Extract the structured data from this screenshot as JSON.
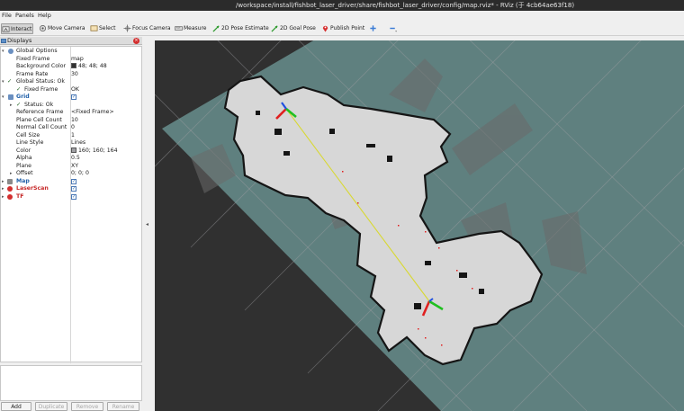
{
  "window": {
    "title": "/workspace/install/fishbot_laser_driver/share/fishbot_laser_driver/config/map.rviz* - RViz (于 4cb64ae63f18)"
  },
  "menu": {
    "file": "File",
    "panels": "Panels",
    "help": "Help"
  },
  "toolbar": {
    "interact": "Interact",
    "move_camera": "Move Camera",
    "select": "Select",
    "focus_camera": "Focus Camera",
    "measure": "Measure",
    "pose_estimate": "2D Pose Estimate",
    "goal_pose": "2D Goal Pose",
    "publish_point": "Publish Point"
  },
  "displays_panel": {
    "title": "Displays",
    "global_options": "Global Options",
    "fixed_frame": {
      "label": "Fixed Frame",
      "value": "map"
    },
    "background_color": {
      "label": "Background Color",
      "value": "48; 48; 48"
    },
    "frame_rate": {
      "label": "Frame Rate",
      "value": "30"
    },
    "global_status": "Global Status: Ok",
    "fixed_frame_status": {
      "label": "Fixed Frame",
      "value": "OK"
    },
    "grid": "Grid",
    "grid_status": "Status: Ok",
    "reference_frame": {
      "label": "Reference Frame",
      "value": "<Fixed Frame>"
    },
    "plane_cell_count": {
      "label": "Plane Cell Count",
      "value": "10"
    },
    "normal_cell_count": {
      "label": "Normal Cell Count",
      "value": "0"
    },
    "cell_size": {
      "label": "Cell Size",
      "value": "1"
    },
    "line_style": {
      "label": "Line Style",
      "value": "Lines"
    },
    "color": {
      "label": "Color",
      "value": "160; 160; 164"
    },
    "alpha": {
      "label": "Alpha",
      "value": "0.5"
    },
    "plane": {
      "label": "Plane",
      "value": "XY"
    },
    "offset": {
      "label": "Offset",
      "value": "0; 0; 0"
    },
    "map": "Map",
    "laser_scan": "LaserScan",
    "tf": "TF",
    "checkmark": "✓"
  },
  "buttons": {
    "add": "Add",
    "duplicate": "Duplicate",
    "remove": "Remove",
    "rename": "Rename"
  },
  "colors": {
    "background": "#303030",
    "grid_color": "#a0a0a4",
    "map_unknown": "#5f807f",
    "map_free": "#d7d7d7",
    "map_occupied": "#151515",
    "axis_x": "#e02020",
    "axis_y": "#20c020",
    "axis_z": "#2050e0"
  }
}
